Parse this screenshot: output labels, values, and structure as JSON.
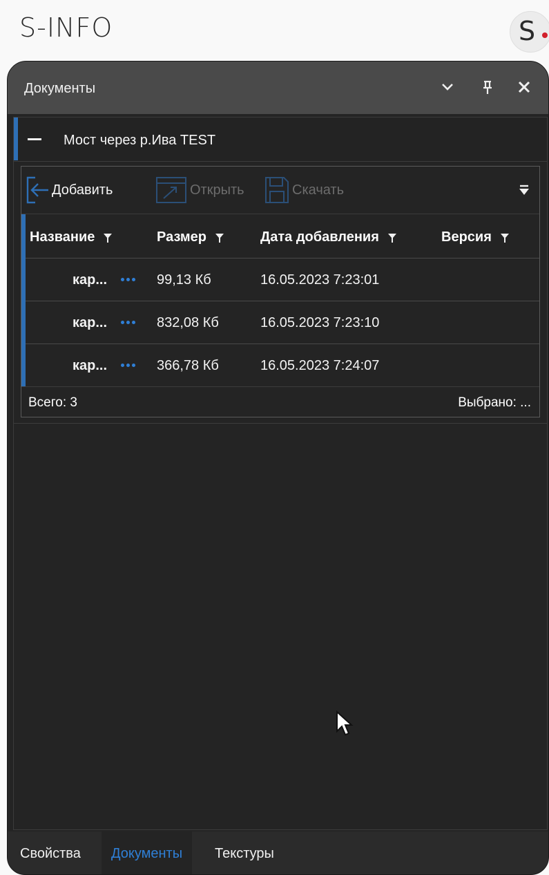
{
  "app": {
    "title": "S-INFO",
    "logo_letter": "S"
  },
  "window": {
    "title": "Документы",
    "buttons": {
      "dropdown": "chevron-down-icon",
      "pin": "pin-icon",
      "close": "close-icon"
    }
  },
  "group": {
    "name": "Мост через р.Ива TEST"
  },
  "toolbar": {
    "add": "Добавить",
    "open": "Открыть",
    "download": "Скачать"
  },
  "table": {
    "columns": [
      "Название",
      "Размер",
      "Дата добавления",
      "Версия"
    ],
    "rows": [
      {
        "name": "кар...",
        "size": "99,13 Кб",
        "date": "16.05.2023 7:23:01",
        "version": ""
      },
      {
        "name": "кар...",
        "size": "832,08 Кб",
        "date": "16.05.2023 7:23:10",
        "version": ""
      },
      {
        "name": "кар...",
        "size": "366,78 Кб",
        "date": "16.05.2023 7:24:07",
        "version": ""
      }
    ]
  },
  "footer": {
    "total": "Всего: 3",
    "selected": "Выбрано: ..."
  },
  "tabs": [
    {
      "label": "Свойства",
      "active": false
    },
    {
      "label": "Документы",
      "active": true
    },
    {
      "label": "Текстуры",
      "active": false
    }
  ],
  "colors": {
    "accent": "#2e6fb5",
    "link": "#2f7fd6",
    "logo_dot": "#d21f2b",
    "background": "#242424"
  }
}
